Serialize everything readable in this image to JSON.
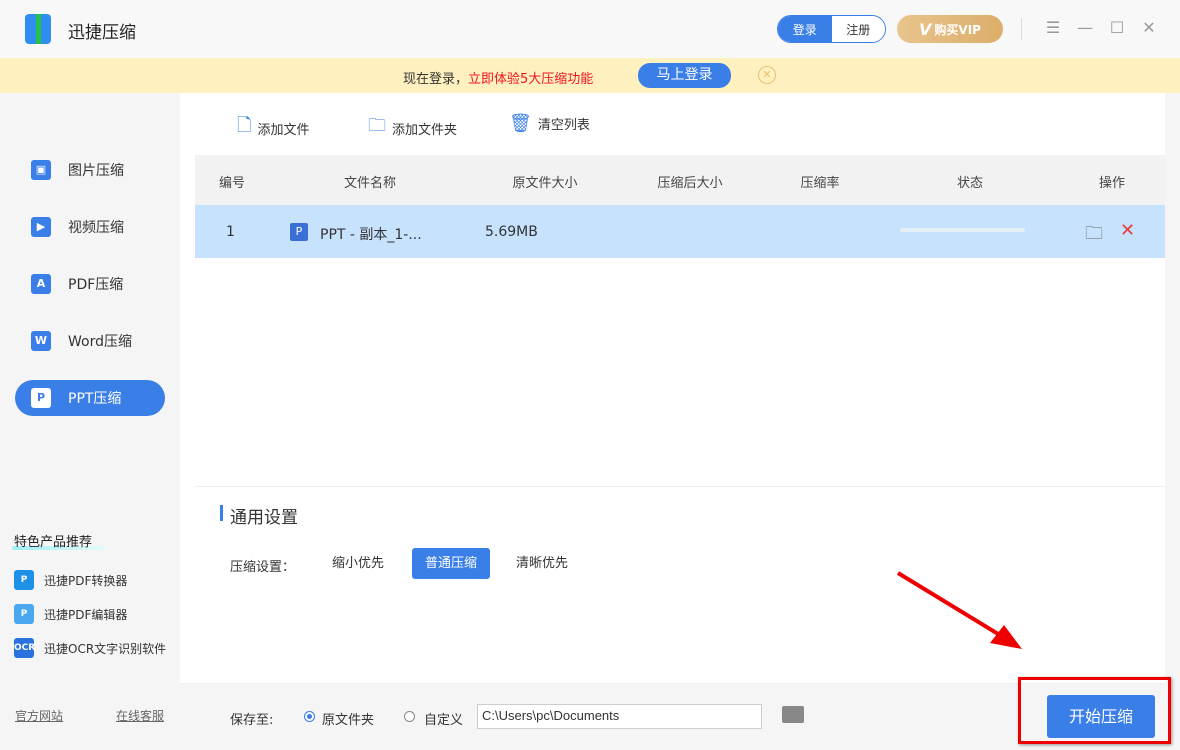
{
  "app": {
    "title": "迅捷压缩",
    "login": "登录",
    "register": "注册",
    "vip": "购买VIP"
  },
  "banner": {
    "text": "现在登录，",
    "highlight": "立即体验5大压缩功能",
    "button": "马上登录"
  },
  "sidebar": {
    "items": [
      {
        "label": "图片压缩",
        "icon": "image-icon"
      },
      {
        "label": "视频压缩",
        "icon": "video-icon"
      },
      {
        "label": "PDF压缩",
        "icon": "pdf-icon"
      },
      {
        "label": "Word压缩",
        "icon": "word-icon"
      },
      {
        "label": "PPT压缩",
        "icon": "ppt-icon",
        "active": true
      }
    ],
    "featured_title": "特色产品推荐",
    "products": [
      "迅捷PDF转换器",
      "迅捷PDF编辑器",
      "迅捷OCR文字识别软件"
    ],
    "links": [
      "官方网站",
      "在线客服"
    ]
  },
  "toolbar": {
    "add_file": "添加文件",
    "add_folder": "添加文件夹",
    "clear": "清空列表"
  },
  "table": {
    "headers": [
      "编号",
      "文件名称",
      "原文件大小",
      "压缩后大小",
      "压缩率",
      "状态",
      "操作"
    ],
    "rows": [
      {
        "id": "1",
        "name": "PPT - 副本_1-...",
        "size": "5.69MB",
        "compressed": "",
        "ratio": "",
        "progress": 0
      }
    ]
  },
  "settings": {
    "title": "通用设置",
    "label": "压缩设置：",
    "options": [
      "缩小优先",
      "普通压缩",
      "清晰优先"
    ],
    "selected": "普通压缩"
  },
  "save": {
    "label": "保存至:",
    "original": "原文件夹",
    "custom": "自定义",
    "path": "C:\\Users\\pc\\Documents",
    "start": "开始压缩"
  },
  "colors": {
    "accent": "#3a7ee8",
    "row_selected": "#c6e2fd",
    "banner": "#fff0c0",
    "annotation": "#e00000"
  }
}
